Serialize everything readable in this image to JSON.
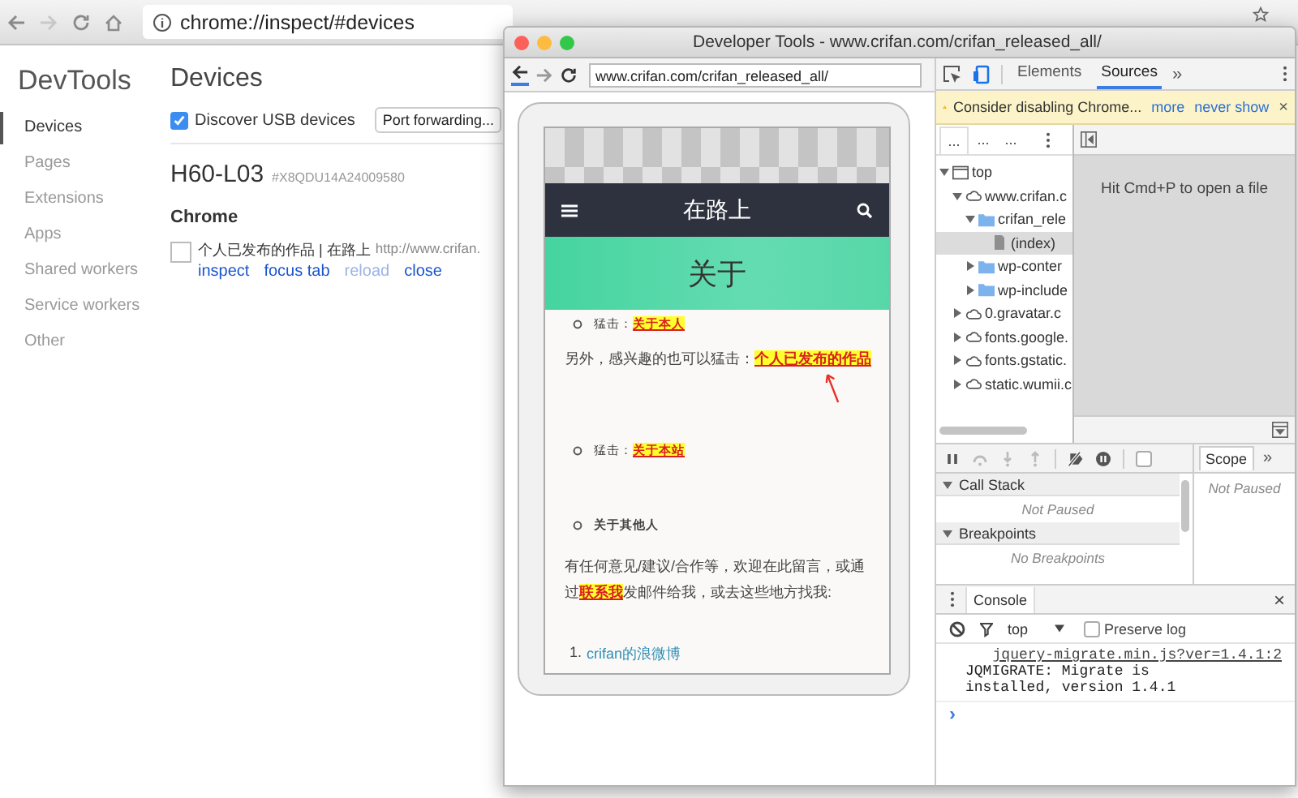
{
  "browser": {
    "address": "chrome://inspect/#devices"
  },
  "sidebar": {
    "title": "DevTools",
    "items": [
      {
        "label": "Devices",
        "selected": true
      },
      {
        "label": "Pages",
        "selected": false
      },
      {
        "label": "Extensions",
        "selected": false
      },
      {
        "label": "Apps",
        "selected": false
      },
      {
        "label": "Shared workers",
        "selected": false
      },
      {
        "label": "Service workers",
        "selected": false
      },
      {
        "label": "Other",
        "selected": false
      }
    ]
  },
  "main": {
    "title": "Devices",
    "discover_usb": {
      "label": "Discover USB devices",
      "checked": true
    },
    "port_forwarding": "Port forwarding...",
    "device": {
      "name": "H60-L03",
      "serial": "#X8QDU14A24009580"
    },
    "browser_name": "Chrome",
    "target": {
      "checked": false,
      "title": "个人已发布的作品 | 在路上",
      "url": "http://www.crifan.",
      "actions": [
        {
          "label": "inspect",
          "disabled": false
        },
        {
          "label": "focus tab",
          "disabled": false
        },
        {
          "label": "reload",
          "disabled": true
        },
        {
          "label": "close",
          "disabled": false
        }
      ]
    }
  },
  "devtools": {
    "title": "Developer Tools - www.crifan.com/crifan_released_all/",
    "device_url": "www.crifan.com/crifan_released_all/",
    "phone": {
      "site_title": "在路上",
      "banner": "关于",
      "content": [
        {
          "kind": "bullet",
          "text": "猛击：",
          "link": "关于本人"
        },
        {
          "kind": "paragraph",
          "text": "另外，感兴趣的也可以猛击：",
          "link": "个人已发布的作品",
          "arrow": true
        },
        {
          "kind": "bullet",
          "text": "猛击：",
          "link": "关于本站"
        },
        {
          "kind": "bullet",
          "text": "关于其他人",
          "bold": true
        },
        {
          "kind": "paragraph",
          "text": "有任何意见/建议/合作等，欢迎在此留言，或通过",
          "link": "联系我",
          "after": "发邮件给我，或去这些地方找我:"
        },
        {
          "kind": "numbered",
          "number": "1.",
          "link": "crifan的浪微博"
        }
      ]
    },
    "tabs": [
      {
        "label": "Elements",
        "selected": false
      },
      {
        "label": "Sources",
        "selected": true
      }
    ],
    "more_tabs": "»",
    "warning": {
      "text": "Consider disabling Chrome...",
      "links": [
        "more",
        "never show"
      ],
      "close": "×"
    },
    "navigator": {
      "tabs": [
        {
          "label": "...",
          "selected": true
        },
        {
          "label": "...",
          "selected": false
        },
        {
          "label": "...",
          "selected": false
        }
      ],
      "tree": [
        {
          "kind": "frame",
          "label": "top",
          "expanded": true,
          "selected": false,
          "children": [
            {
              "kind": "domain",
              "label": "www.crifan.c",
              "expanded": true,
              "selected": false,
              "children": [
                {
                  "kind": "folder",
                  "label": "crifan_rele",
                  "expanded": true,
                  "selected": false,
                  "children": [
                    {
                      "kind": "file",
                      "label": "(index)",
                      "selected": true
                    }
                  ]
                },
                {
                  "kind": "folder",
                  "label": "wp-conter",
                  "expanded": false,
                  "selected": false
                },
                {
                  "kind": "folder",
                  "label": "wp-include",
                  "expanded": false,
                  "selected": false
                }
              ]
            },
            {
              "kind": "domain",
              "label": "0.gravatar.c",
              "expanded": false,
              "selected": false
            },
            {
              "kind": "domain",
              "label": "fonts.google.",
              "expanded": false,
              "selected": false
            },
            {
              "kind": "domain",
              "label": "fonts.gstatic.",
              "expanded": false,
              "selected": false
            },
            {
              "kind": "domain",
              "label": "static.wumii.c",
              "expanded": false,
              "selected": false
            }
          ]
        }
      ]
    },
    "editor_hint": "Hit Cmd+P to open a file",
    "debugger": {
      "caught_exceptions": {
        "checked": false
      },
      "sections": [
        {
          "title": "Call Stack",
          "expanded": true,
          "empty": "Not Paused"
        },
        {
          "title": "Breakpoints",
          "expanded": true,
          "empty": "No Breakpoints"
        }
      ],
      "side_tabs": [
        {
          "label": "Scope",
          "selected": true
        }
      ],
      "more": "»",
      "scope_text": "Not Paused"
    },
    "console": {
      "tab": "Console",
      "close": "×",
      "context": "top",
      "preserve_log": {
        "label": "Preserve log",
        "checked": false
      },
      "messages": [
        {
          "source": "jquery-migrate.min.js?ver=1.4.1:2",
          "text": "JQMIGRATE: Migrate is installed, version 1.4.1"
        }
      ],
      "prompt": "›"
    }
  }
}
